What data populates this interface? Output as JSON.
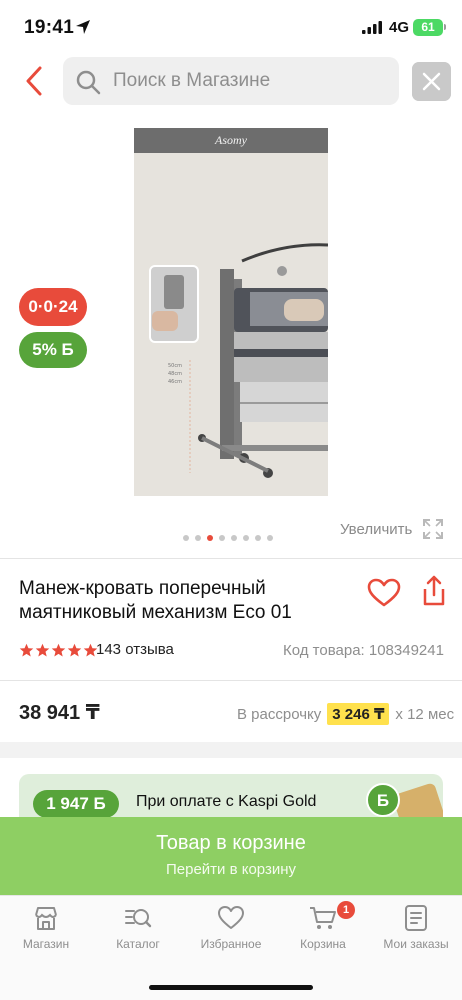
{
  "status_bar": {
    "time": "19:41",
    "network": "4G",
    "battery": "61"
  },
  "search": {
    "placeholder": "Поиск в Магазине"
  },
  "gallery": {
    "image_brand": "Asomy",
    "badge_installment": "0·0·24",
    "badge_bonus": "5% Б",
    "zoom_label": "Увеличить",
    "dots_total": 8,
    "active_dot": 2
  },
  "product": {
    "title": "Манеж-кровать поперечный маятниковый механизм Eco 01",
    "rating": 5,
    "reviews": "143 отзыва",
    "code": "Код товара: 108349241"
  },
  "pricing": {
    "price": "38 941 ₸",
    "installment_prefix": "В рассрочку",
    "installment_amount": "3 246 ₸",
    "installment_suffix": "х 12 мес"
  },
  "kaspi_gold": {
    "bonus": "1 947 Б",
    "text": "При оплате с Kaspi Gold",
    "coin_letter": "Б"
  },
  "cart_banner": {
    "title": "Товар в корзине",
    "subtitle": "Перейти в корзину"
  },
  "nav": {
    "tabs": [
      {
        "label": "Магазин",
        "icon": "store-icon"
      },
      {
        "label": "Каталог",
        "icon": "catalog-search-icon"
      },
      {
        "label": "Избранное",
        "icon": "heart-icon"
      },
      {
        "label": "Корзина",
        "icon": "cart-icon"
      },
      {
        "label": "Мои заказы",
        "icon": "orders-icon"
      }
    ],
    "cart_count": "1"
  },
  "colors": {
    "accent_red": "#e84b3b",
    "bonus_green": "#57a43a",
    "cart_banner_green": "#8ecf63",
    "installment_yellow": "#ffe14d"
  }
}
